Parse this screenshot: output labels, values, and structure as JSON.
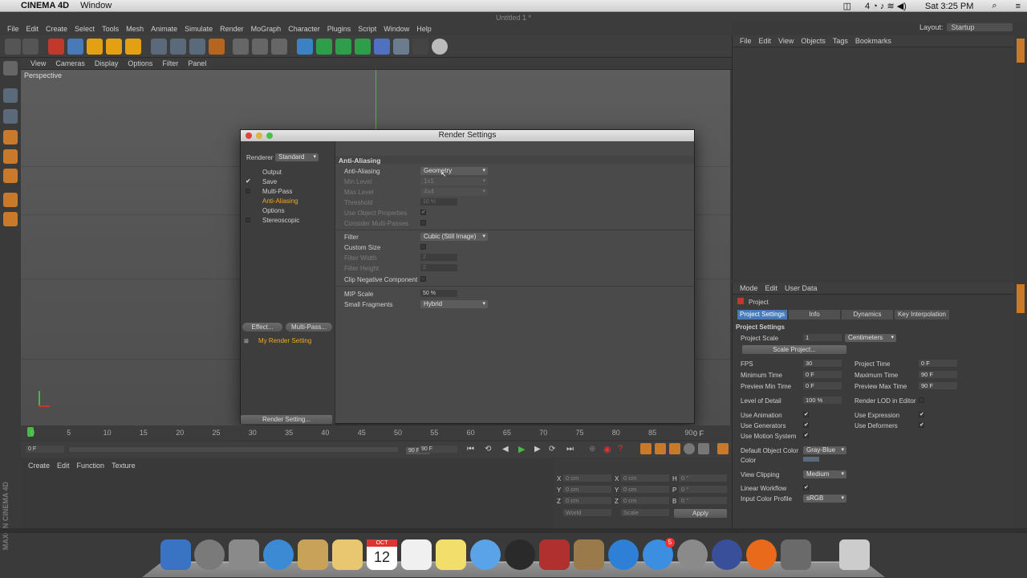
{
  "macmenu": {
    "app": "CINEMA 4D",
    "window": "Window",
    "clock": "Sat 3:25 PM",
    "badge": "4"
  },
  "window_title": "Untitled 1 *",
  "mainmenu": [
    "File",
    "Edit",
    "Create",
    "Select",
    "Tools",
    "Mesh",
    "Animate",
    "Simulate",
    "Render",
    "MoGraph",
    "Character",
    "Plugins",
    "Script",
    "Window",
    "Help"
  ],
  "layout": {
    "label": "Layout:",
    "value": "Startup"
  },
  "viewport": {
    "menu": [
      "View",
      "Cameras",
      "Display",
      "Options",
      "Filter",
      "Panel"
    ],
    "label": "Perspective"
  },
  "render_dialog": {
    "title": "Render Settings",
    "renderer_label": "Renderer",
    "renderer_value": "Standard",
    "nav": [
      "Output",
      "Save",
      "Multi-Pass",
      "Anti-Aliasing",
      "Options",
      "Stereoscopic"
    ],
    "effect_btn": "Effect...",
    "multipass_btn": "Multi-Pass...",
    "setting_name": "My Render Setting",
    "render_setting_btn": "Render Setting...",
    "section": "Anti-Aliasing",
    "aa_label": "Anti-Aliasing",
    "aa_value": "Geometry",
    "min_level_label": "Min Level",
    "min_level": "1x1",
    "max_level_label": "Max Level",
    "max_level": "4x4",
    "threshold_label": "Threshold",
    "threshold": "10 %",
    "use_obj_props": "Use Object Properties",
    "consider_mp": "Consider Multi-Passes",
    "filter_label": "Filter",
    "filter_value": "Cubic (Still Image)",
    "custom_size": "Custom Size",
    "filter_width_label": "Filter Width",
    "filter_width": "2",
    "filter_height_label": "Filter Height",
    "filter_height": "2",
    "clip_neg": "Clip Negative Component",
    "mip_label": "MIP Scale",
    "mip_value": "50 %",
    "small_frag_label": "Small Fragments",
    "small_frag_value": "Hybrid"
  },
  "timeline": {
    "ticks": [
      "0",
      "5",
      "10",
      "15",
      "20",
      "25",
      "30",
      "35",
      "40",
      "45",
      "50",
      "55",
      "60",
      "65",
      "70",
      "75",
      "80",
      "85",
      "90"
    ],
    "end": "0 F"
  },
  "transport": {
    "start": "0 F",
    "mid": "90 F",
    "end": "90 F"
  },
  "material_menu": [
    "Create",
    "Edit",
    "Function",
    "Texture"
  ],
  "coords": {
    "x": "0 cm",
    "y": "0 cm",
    "z": "0 cm",
    "h": "0 °",
    "p": "0 °",
    "b": "0 °",
    "world": "World",
    "scale": "Scale",
    "apply": "Apply"
  },
  "object_manager_menu": [
    "File",
    "Edit",
    "View",
    "Objects",
    "Tags",
    "Bookmarks"
  ],
  "attr": {
    "menu": [
      "Mode",
      "Edit",
      "User Data"
    ],
    "object": "Project",
    "tabs": [
      "Project Settings",
      "Info",
      "Dynamics",
      "Key Interpolation"
    ],
    "section": "Project Settings",
    "project_scale_label": "Project Scale",
    "project_scale": "1",
    "units": "Centimeters",
    "scale_project_btn": "Scale Project...",
    "fps_label": "FPS",
    "fps": "30",
    "project_time_label": "Project Time",
    "project_time": "0 F",
    "min_time_label": "Minimum Time",
    "min_time": "0 F",
    "max_time_label": "Maximum Time",
    "max_time": "90 F",
    "prev_min_label": "Preview Min Time",
    "prev_min": "0 F",
    "prev_max_label": "Preview Max Time",
    "prev_max": "90 F",
    "lod_label": "Level of Detail",
    "lod": "100 %",
    "render_lod_label": "Render LOD in Editor",
    "use_anim": "Use Animation",
    "use_expr": "Use Expression",
    "use_gen": "Use Generators",
    "use_def": "Use Deformers",
    "use_motion": "Use Motion System",
    "def_color_label": "Default Object Color",
    "def_color": "Gray-Blue",
    "color_label": "Color",
    "view_clip_label": "View Clipping",
    "view_clip": "Medium",
    "linear_wf": "Linear Workflow",
    "input_profile_label": "Input Color Profile",
    "input_profile": "sRGB"
  },
  "dock_badge": "5",
  "calendar_day": "12",
  "calendar_month": "OCT",
  "colors": {
    "accent": "#f5a623",
    "tab_active": "#4a79b8",
    "panel": "#3b3b3b"
  }
}
